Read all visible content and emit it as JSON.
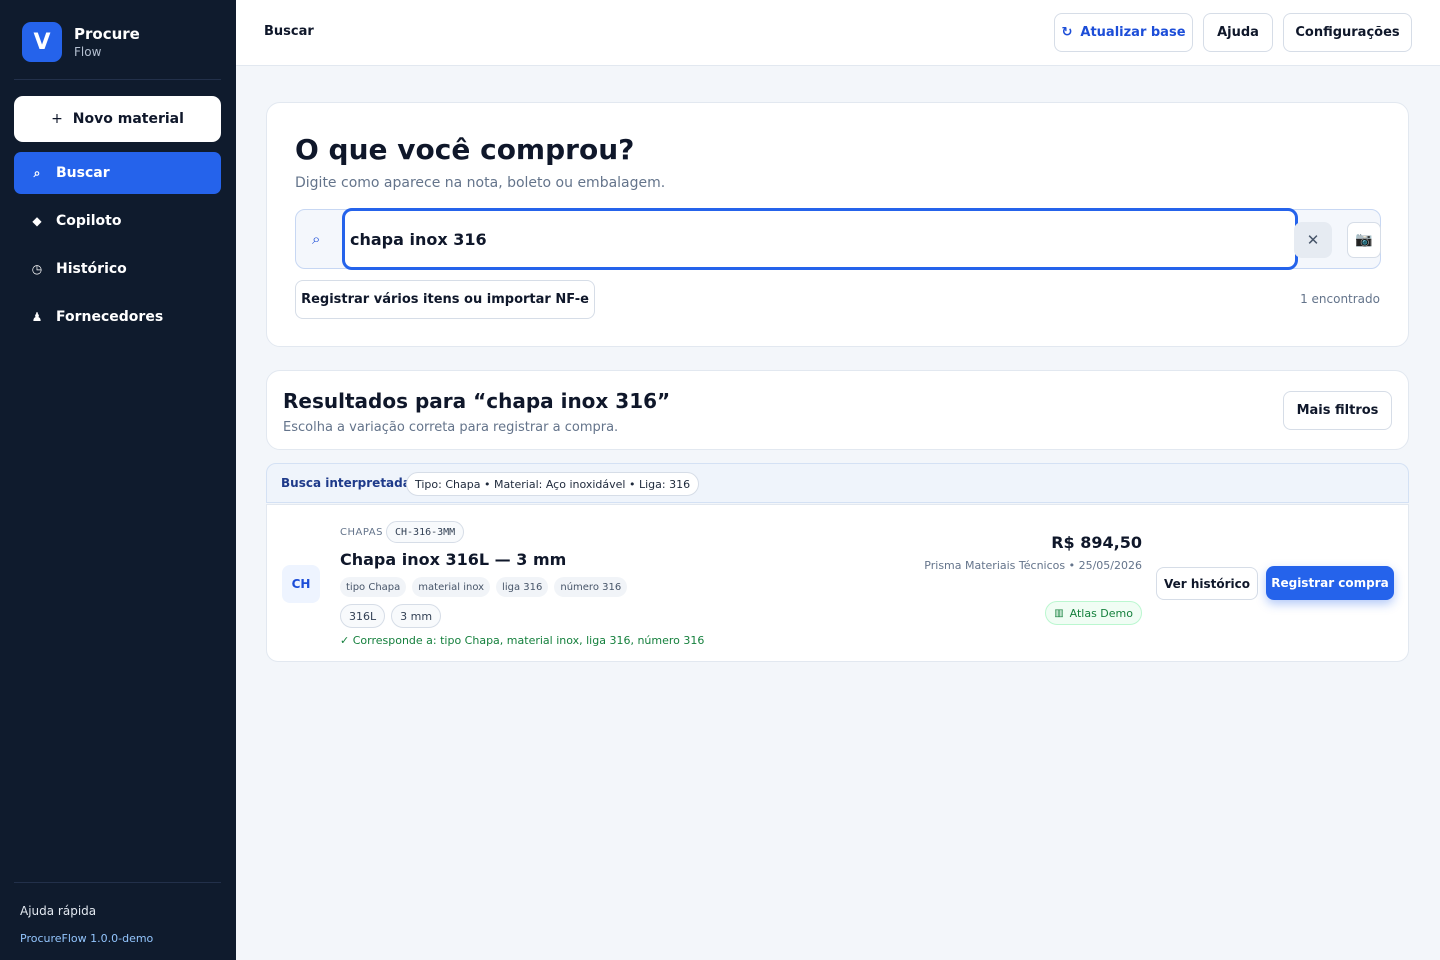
{
  "brand": {
    "logo_letter": "V",
    "name": "Procure",
    "sub": "Flow",
    "accent": "#2563eb"
  },
  "sidebar": {
    "new_button": {
      "icon": "+",
      "label": "Novo material"
    },
    "items": [
      {
        "icon": "⌕",
        "icon_name": "search-icon",
        "label": "Buscar",
        "active": true
      },
      {
        "icon": "◆",
        "icon_name": "diamond-icon",
        "label": "Copiloto",
        "active": false
      },
      {
        "icon": "◷",
        "icon_name": "clock-icon",
        "label": "Histórico",
        "active": false
      },
      {
        "icon": "♟",
        "icon_name": "person-icon",
        "label": "Fornecedores",
        "active": false
      }
    ],
    "footer_help": "Ajuda rápida",
    "footer_version": "ProcureFlow 1.0.0-demo"
  },
  "header": {
    "breadcrumb": "Buscar",
    "refresh": {
      "icon": "↻",
      "label": "Atualizar base"
    },
    "help_label": "Ajuda",
    "settings_label": "Configurações"
  },
  "search": {
    "title": "O que você comprou?",
    "subtitle": "Digite como aparece na nota, boleto ou embalagem.",
    "search_icon": "⌕",
    "value": "chapa inox 316",
    "clear_icon": "✕",
    "camera_icon": "📷",
    "multi_label": "Registrar vários itens ou importar NF-e",
    "found_count": "1 encontrado"
  },
  "results": {
    "title": "Resultados para “chapa inox 316”",
    "subtitle": "Escolha a variação correta para registrar a compra.",
    "filters_label": "Mais filtros",
    "interpreted_label": "Busca interpretada",
    "interpreted_value": "Tipo: Chapa • Material: Aço inoxidável • Liga: 316",
    "items": [
      {
        "avatar": "CH",
        "category": "CHAPAS",
        "sku": "CH-316-3MM",
        "title": "Chapa inox 316L — 3 mm",
        "tags": [
          "tipo Chapa",
          "material inox",
          "liga 316",
          "número 316"
        ],
        "specs": [
          "316L",
          "3 mm"
        ],
        "match": "✓ Corresponde a: tipo Chapa, material inox, liga 316, número 316",
        "price": "R$ 894,50",
        "supplier": "Prisma Materiais Técnicos • 25/05/2026",
        "source_icon": "▥",
        "source": "Atlas Demo",
        "history_label": "Ver histórico",
        "register_label": "Registrar compra"
      }
    ]
  }
}
